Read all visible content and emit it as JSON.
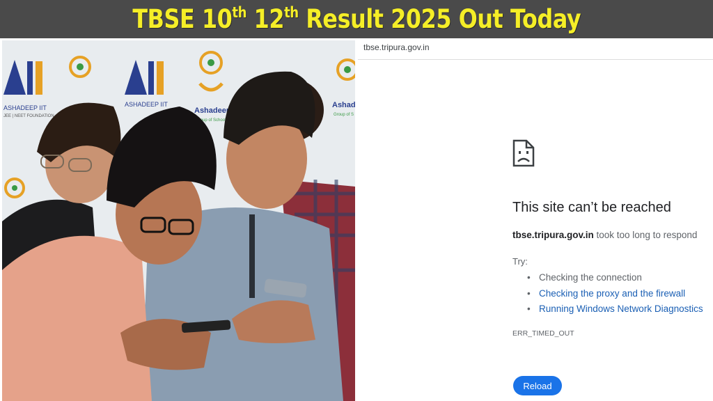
{
  "headline": {
    "part1": "TBSE 10",
    "sup1": "th",
    "part2": " 12",
    "sup2": "th",
    "part3": " Result 2025 Out Today",
    "color": "#f5ee27",
    "background": "#4a4a4a"
  },
  "photo": {
    "backdrop_logos": [
      "Ashadeep IIT",
      "Ashadeep"
    ],
    "backdrop_small_text": [
      "Group of Schools",
      "Group of S",
      "ASHADEEP IIT",
      "JEE | NEET FOUNDATION"
    ]
  },
  "browser": {
    "url": "tbse.tripura.gov.in",
    "error_icon": "sad-document-icon",
    "title": "This site can’t be reached",
    "description_host": "tbse.tripura.gov.in",
    "description_rest": " took too long to respond",
    "try_label": "Try:",
    "suggestions": [
      {
        "label": "Checking the connection",
        "is_link": false
      },
      {
        "label": "Checking the proxy and the firewall",
        "is_link": true
      },
      {
        "label": "Running Windows Network Diagnostics",
        "is_link": true
      }
    ],
    "error_code": "ERR_TIMED_OUT",
    "reload_label": "Reload",
    "accent": "#1a73e8"
  }
}
